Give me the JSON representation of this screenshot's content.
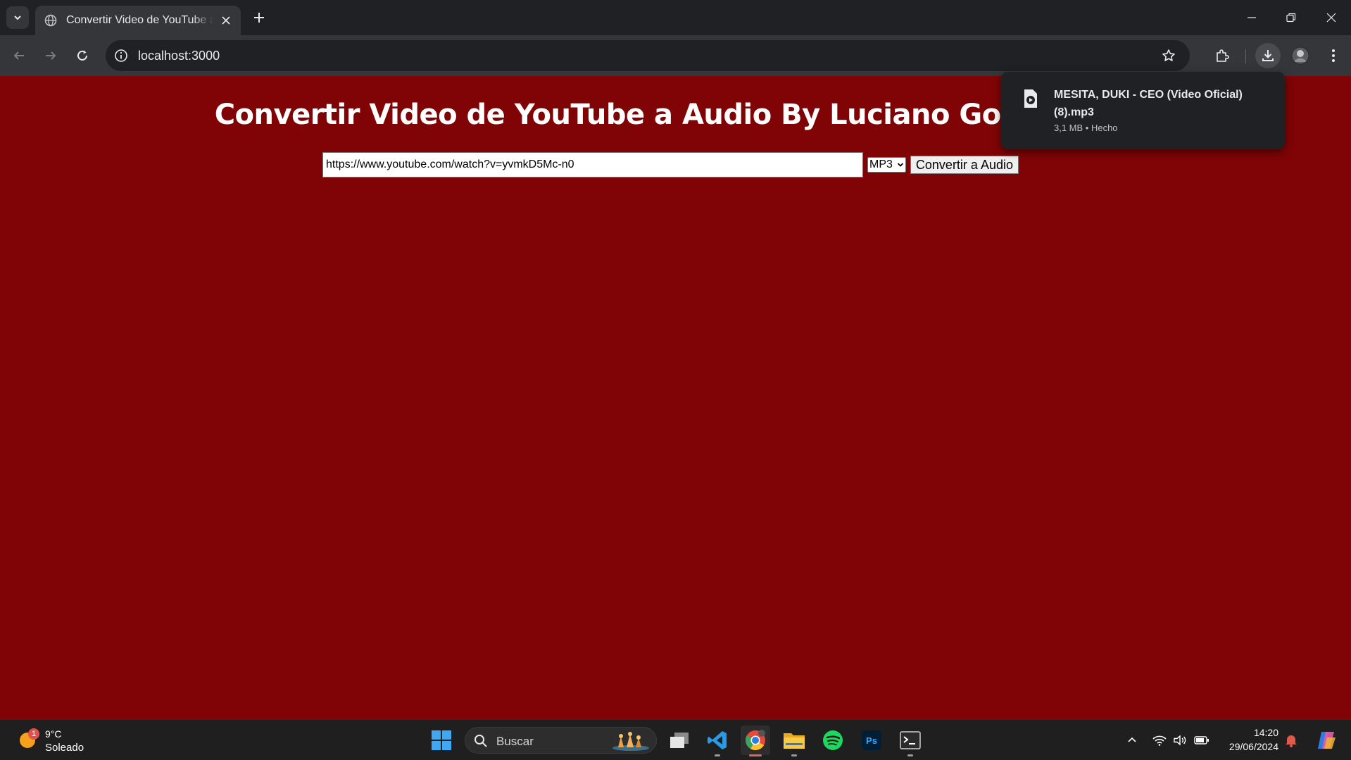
{
  "browser": {
    "tab_title": "Convertir Video de YouTube a Audio",
    "url": "localhost:3000"
  },
  "page": {
    "heading": "Convertir Video de YouTube a Audio By Luciano Gonzalez M",
    "url_input_value": "https://www.youtube.com/watch?v=yvmkD5Mc-n0",
    "format_selected": "MP3",
    "convert_label": "Convertir a Audio"
  },
  "download": {
    "filename": "MESITA, DUKI - CEO (Video Oficial) (8).mp3",
    "meta": "3,1 MB • Hecho"
  },
  "taskbar": {
    "weather_badge": "1",
    "temperature": "9°C",
    "condition": "Soleado",
    "search_label": "Buscar",
    "time": "14:20",
    "date": "29/06/2024"
  },
  "colors": {
    "page_background": "#800405",
    "chrome_dark": "#202124",
    "chrome_toolbar": "#35363a"
  }
}
